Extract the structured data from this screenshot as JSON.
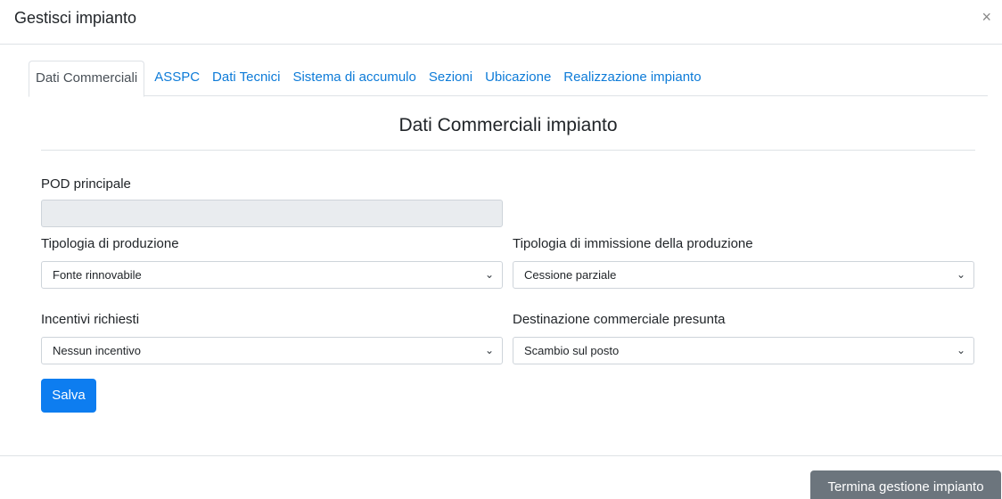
{
  "modal": {
    "title": "Gestisci impianto",
    "close_icon": "×"
  },
  "tabs": [
    {
      "label": "Dati Commerciali",
      "active": true
    },
    {
      "label": "ASSPC"
    },
    {
      "label": "Dati Tecnici"
    },
    {
      "label": "Sistema di accumulo"
    },
    {
      "label": "Sezioni"
    },
    {
      "label": "Ubicazione"
    },
    {
      "label": "Realizzazione impianto"
    }
  ],
  "section": {
    "title": "Dati Commerciali impianto"
  },
  "form": {
    "pod_label": "POD principale",
    "pod_value": "",
    "tipologia_produzione_label": "Tipologia di produzione",
    "tipologia_produzione_value": "Fonte rinnovabile",
    "tipologia_immissione_label": "Tipologia di immissione della produzione",
    "tipologia_immissione_value": "Cessione parziale",
    "incentivi_label": "Incentivi richiesti",
    "incentivi_value": "Nessun incentivo",
    "destinazione_label": "Destinazione commerciale presunta",
    "destinazione_value": "Scambio sul posto",
    "chevron_icon": "chevron-down-icon",
    "save_label": "Salva"
  },
  "footer": {
    "end_label": "Termina gestione impianto"
  },
  "colors": {
    "link": "#0d7bd8",
    "primary": "#0d7df0",
    "secondary": "#6c757d",
    "readonly_bg": "#e9ecef"
  }
}
